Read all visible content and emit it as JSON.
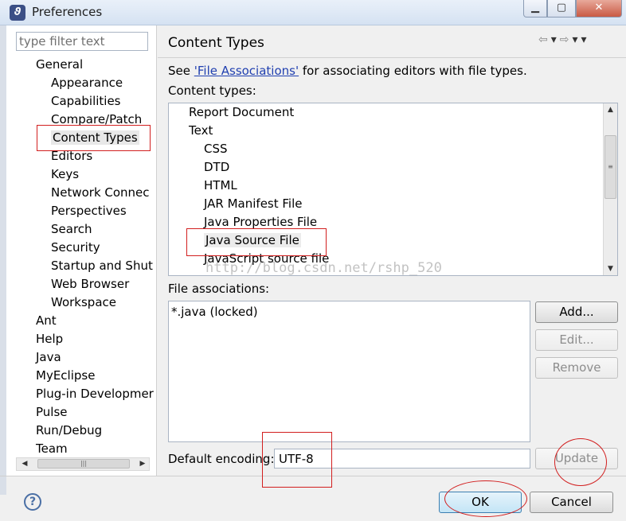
{
  "window": {
    "title": "Preferences"
  },
  "filter": {
    "placeholder": "type filter text"
  },
  "tree": [
    {
      "label": "General",
      "level": 0
    },
    {
      "label": "Appearance",
      "level": 1
    },
    {
      "label": "Capabilities",
      "level": 1
    },
    {
      "label": "Compare/Patch",
      "level": 1
    },
    {
      "label": "Content Types",
      "level": 1,
      "selected": true
    },
    {
      "label": "Editors",
      "level": 1
    },
    {
      "label": "Keys",
      "level": 1
    },
    {
      "label": "Network Connec",
      "level": 1
    },
    {
      "label": "Perspectives",
      "level": 1
    },
    {
      "label": "Search",
      "level": 1
    },
    {
      "label": "Security",
      "level": 1
    },
    {
      "label": "Startup and Shut",
      "level": 1
    },
    {
      "label": "Web Browser",
      "level": 1
    },
    {
      "label": "Workspace",
      "level": 1
    },
    {
      "label": "Ant",
      "level": 0
    },
    {
      "label": "Help",
      "level": 0
    },
    {
      "label": "Java",
      "level": 0
    },
    {
      "label": "MyEclipse",
      "level": 0
    },
    {
      "label": "Plug-in Developmer",
      "level": 0
    },
    {
      "label": "Pulse",
      "level": 0
    },
    {
      "label": "Run/Debug",
      "level": 0
    },
    {
      "label": "Team",
      "level": 0
    }
  ],
  "page": {
    "title": "Content Types",
    "see_prefix": "See ",
    "see_link": "'File Associations'",
    "see_suffix": " for associating editors with file types.",
    "content_types_label": "Content types:",
    "file_associations_label": "File associations:",
    "default_encoding_label": "Default encoding:"
  },
  "content_types": [
    {
      "label": "Report Document",
      "level": 0
    },
    {
      "label": "Text",
      "level": 0
    },
    {
      "label": "CSS",
      "level": 1
    },
    {
      "label": "DTD",
      "level": 1
    },
    {
      "label": "HTML",
      "level": 1
    },
    {
      "label": "JAR Manifest File",
      "level": 1
    },
    {
      "label": "Java Properties File",
      "level": 1
    },
    {
      "label": "Java Source File",
      "level": 1,
      "selected": true
    },
    {
      "label": "JavaScript source file",
      "level": 1
    }
  ],
  "file_associations": [
    "*.java (locked)"
  ],
  "buttons": {
    "add": "Add...",
    "edit": "Edit...",
    "remove": "Remove",
    "update": "Update",
    "ok": "OK",
    "cancel": "Cancel"
  },
  "encoding": {
    "value": "UTF-8"
  },
  "watermark": "http://blog.csdn.net/rshp_520",
  "icons": {
    "app": "eclipse-app-icon",
    "help": "help-icon",
    "nav": [
      "back-arrow-icon",
      "dropdown-icon",
      "forward-arrow-icon",
      "dropdown-icon",
      "view-menu-icon"
    ]
  },
  "colors": {
    "annotation": "#d21f1f",
    "link": "#2140b0",
    "default_button": "#3c7fb1"
  }
}
